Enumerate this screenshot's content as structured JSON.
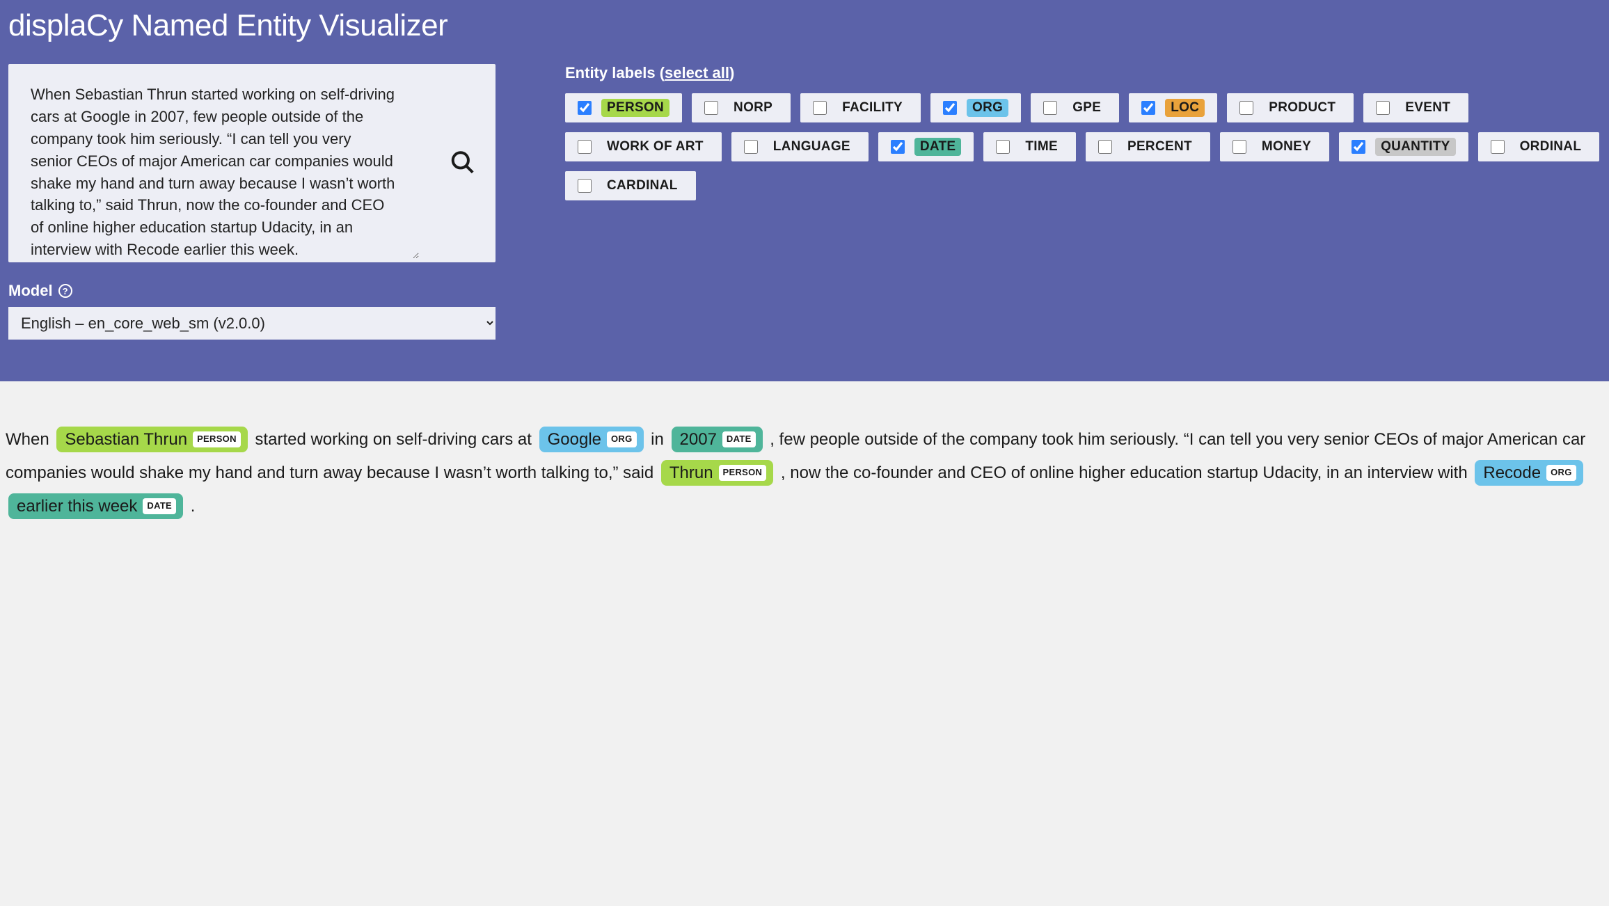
{
  "title": "displaCy Named Entity Visualizer",
  "input_text": "When Sebastian Thrun started working on self-driving cars at Google in 2007, few people outside of the company took him seriously. “I can tell you very senior CEOs of major American car companies would shake my hand and turn away because I wasn’t worth talking to,” said Thrun, now the co-founder and CEO of online higher education startup Udacity, in an interview with Recode earlier this week.",
  "model": {
    "label": "Model",
    "selected": "English – en_core_web_sm (v2.0.0)"
  },
  "labels": {
    "heading_prefix": "Entity labels (",
    "select_all": "select all",
    "heading_suffix": ")",
    "items": [
      {
        "name": "PERSON",
        "checked": true,
        "color": "person"
      },
      {
        "name": "NORP",
        "checked": false,
        "color": "none"
      },
      {
        "name": "FACILITY",
        "checked": false,
        "color": "none"
      },
      {
        "name": "ORG",
        "checked": true,
        "color": "org"
      },
      {
        "name": "GPE",
        "checked": false,
        "color": "none"
      },
      {
        "name": "LOC",
        "checked": true,
        "color": "loc"
      },
      {
        "name": "PRODUCT",
        "checked": false,
        "color": "none"
      },
      {
        "name": "EVENT",
        "checked": false,
        "color": "none"
      },
      {
        "name": "WORK OF ART",
        "checked": false,
        "color": "none"
      },
      {
        "name": "LANGUAGE",
        "checked": false,
        "color": "none"
      },
      {
        "name": "DATE",
        "checked": true,
        "color": "date"
      },
      {
        "name": "TIME",
        "checked": false,
        "color": "none"
      },
      {
        "name": "PERCENT",
        "checked": false,
        "color": "none"
      },
      {
        "name": "MONEY",
        "checked": false,
        "color": "none"
      },
      {
        "name": "QUANTITY",
        "checked": true,
        "color": "quantity"
      },
      {
        "name": "ORDINAL",
        "checked": false,
        "color": "none"
      },
      {
        "name": "CARDINAL",
        "checked": false,
        "color": "none"
      }
    ]
  },
  "output": {
    "tokens": [
      {
        "type": "text",
        "text": "When "
      },
      {
        "type": "entity",
        "text": "Sebastian Thrun",
        "label": "PERSON",
        "color": "person"
      },
      {
        "type": "text",
        "text": " started working on self-driving cars at "
      },
      {
        "type": "entity",
        "text": "Google",
        "label": "ORG",
        "color": "org"
      },
      {
        "type": "text",
        "text": " in "
      },
      {
        "type": "entity",
        "text": "2007",
        "label": "DATE",
        "color": "date"
      },
      {
        "type": "text",
        "text": " , few people outside of the company took him seriously. “I can tell you very senior CEOs of major American car companies would shake my hand and turn away because I wasn’t worth talking to,” said "
      },
      {
        "type": "entity",
        "text": "Thrun",
        "label": "PERSON",
        "color": "person"
      },
      {
        "type": "text",
        "text": " , now the co-founder and CEO of online higher education startup Udacity, in an interview with "
      },
      {
        "type": "entity",
        "text": "Recode",
        "label": "ORG",
        "color": "org"
      },
      {
        "type": "text",
        "text": " "
      },
      {
        "type": "entity",
        "text": "earlier this week",
        "label": "DATE",
        "color": "date"
      },
      {
        "type": "text",
        "text": " ."
      }
    ]
  }
}
